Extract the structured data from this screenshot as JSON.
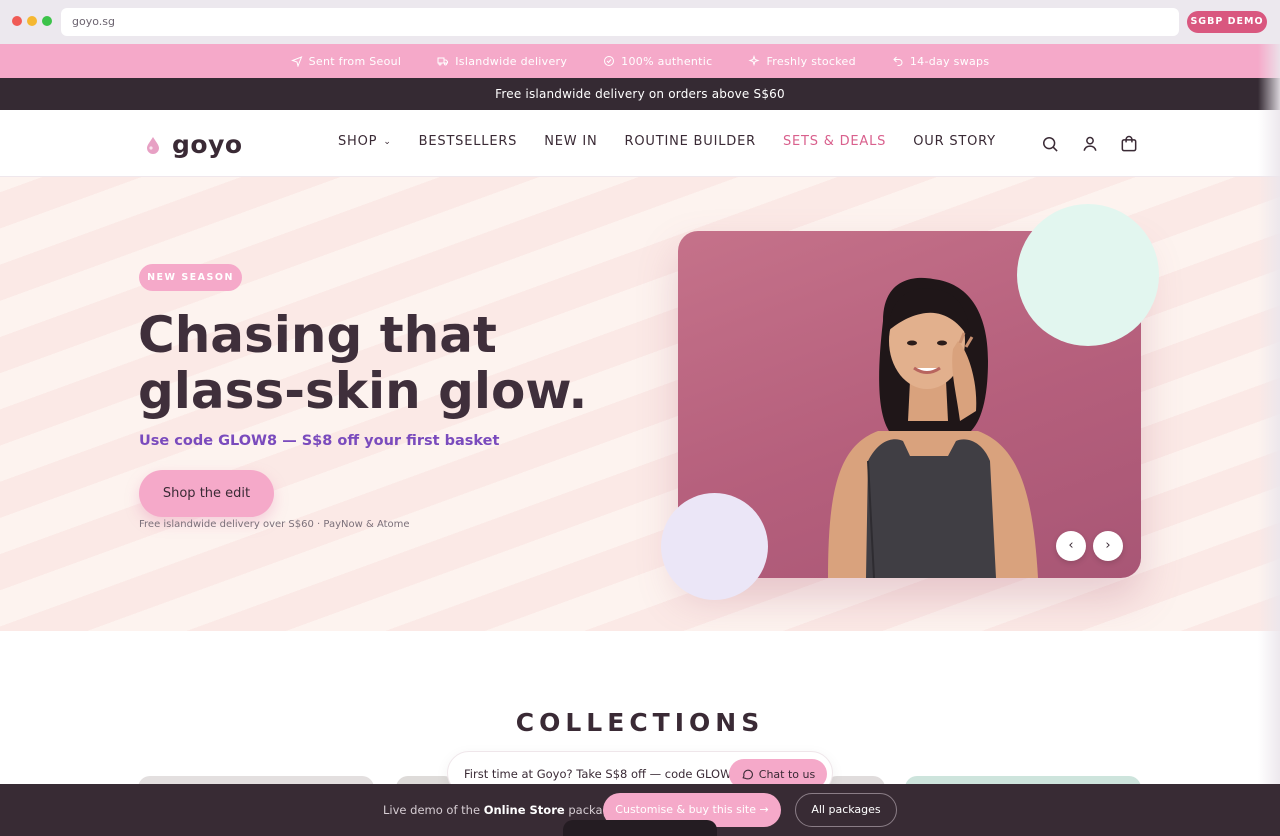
{
  "browser": {
    "url": "goyo.sg",
    "badge": "SGBP DEMO"
  },
  "perks": [
    {
      "icon": "plane-icon",
      "label": "Sent from Seoul"
    },
    {
      "icon": "truck-icon",
      "label": "Islandwide delivery"
    },
    {
      "icon": "check-badge-icon",
      "label": "100% authentic"
    },
    {
      "icon": "sparkle-icon",
      "label": "Freshly stocked"
    },
    {
      "icon": "return-icon",
      "label": "14-day swaps"
    }
  ],
  "announcement": "Free islandwide delivery on orders above S$60",
  "header": {
    "logo": "goyo",
    "nav": [
      "SHOP",
      "BESTSELLERS",
      "NEW IN",
      "ROUTINE BUILDER",
      "SETS & DEALS",
      "OUR STORY"
    ],
    "active_nav": "SETS & DEALS",
    "icons": [
      "search-icon",
      "account-icon",
      "cart-icon"
    ]
  },
  "hero": {
    "tag": "NEW SEASON",
    "title_line1": "Chasing that",
    "title_line2": "glass-skin glow.",
    "subtitle": "Use code GLOW8 — S$8 off your first basket",
    "cta": "Shop the edit",
    "note": "Free islandwide delivery over S$60 · PayNow & Atome",
    "prev": "‹",
    "next": "›"
  },
  "collections": {
    "title": "COLLECTIONS"
  },
  "chat": {
    "text": "First time at Goyo? Take S$8 off — code GLOW8",
    "button": "Chat to us"
  },
  "bottom_bar": {
    "prefix": "Live demo of the ",
    "package": "Online Store",
    "suffix": " package.",
    "customise": "Customise & buy this site →",
    "packages": "All packages"
  },
  "colors": {
    "accent_pink": "#f5a9c9",
    "brand_dark": "#352a33",
    "active_nav": "#d9608d",
    "subtitle_purple": "#7a4bbd"
  }
}
